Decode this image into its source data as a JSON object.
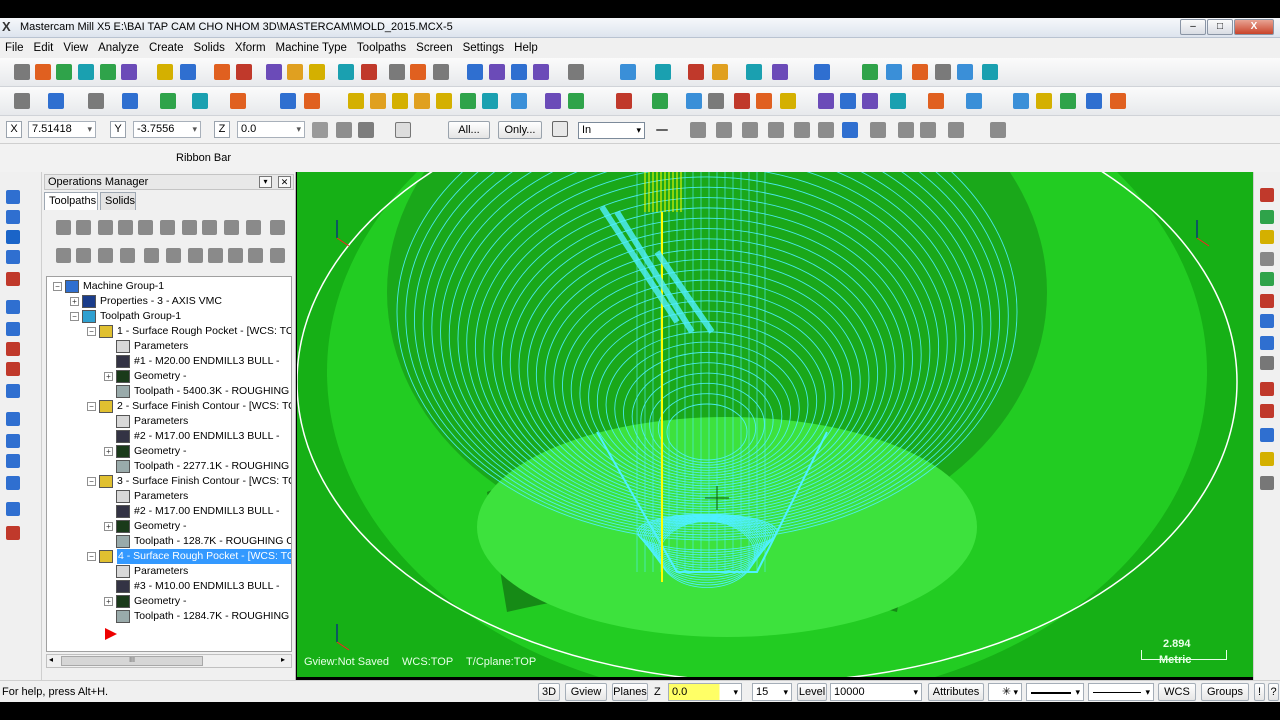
{
  "window": {
    "app_icon": "X",
    "title": "Mastercam Mill X5  E:\\BAI TAP CAM CHO NHOM 3D\\MASTERCAM\\MOLD_2015.MCX-5",
    "min": "–",
    "max": "□",
    "close": "X"
  },
  "menu": [
    "File",
    "Edit",
    "View",
    "Analyze",
    "Create",
    "Solids",
    "Xform",
    "Machine Type",
    "Toolpaths",
    "Screen",
    "Settings",
    "Help"
  ],
  "autocursor": {
    "x_label": "X",
    "x_value": "7.51418",
    "y_label": "Y",
    "y_value": "-3.7556",
    "z_label": "Z",
    "z_value": "0.0",
    "all_button": "All...",
    "only_button": "Only...",
    "mode_select": "In"
  },
  "ribbon_bar": "Ribbon Bar",
  "ops_manager": {
    "title": "Operations Manager",
    "tabs": [
      "Toolpaths",
      "Solids"
    ],
    "tree": [
      {
        "text": "Machine Group-1",
        "icon": "machine-group-icon",
        "level": 0,
        "exp": "−"
      },
      {
        "text": "Properties - 3 - AXIS VMC",
        "icon": "properties-icon",
        "level": 1,
        "exp": "+"
      },
      {
        "text": "Toolpath Group-1",
        "icon": "toolpath-group-icon",
        "level": 1,
        "exp": "−"
      },
      {
        "text": "1 - Surface Rough Pocket - [WCS: TOP",
        "icon": "operation-folder-icon",
        "level": 2,
        "exp": "−"
      },
      {
        "text": "Parameters",
        "icon": "parameters-icon",
        "level": 3,
        "exp": ""
      },
      {
        "text": "#1 - M20.00 ENDMILL3 BULL -",
        "icon": "tool-icon",
        "level": 3,
        "exp": ""
      },
      {
        "text": "Geometry -",
        "icon": "geometry-icon",
        "level": 3,
        "exp": "+"
      },
      {
        "text": "Toolpath - 5400.3K - ROUGHING",
        "icon": "toolpath-icon",
        "level": 3,
        "exp": ""
      },
      {
        "text": "2 - Surface Finish Contour - [WCS: TOP",
        "icon": "operation-folder-icon",
        "level": 2,
        "exp": "−"
      },
      {
        "text": "Parameters",
        "icon": "parameters-icon",
        "level": 3,
        "exp": ""
      },
      {
        "text": "#2 - M17.00 ENDMILL3 BULL -",
        "icon": "tool-icon",
        "level": 3,
        "exp": ""
      },
      {
        "text": "Geometry -",
        "icon": "geometry-icon",
        "level": 3,
        "exp": "+"
      },
      {
        "text": "Toolpath - 2277.1K - ROUGHING",
        "icon": "toolpath-icon",
        "level": 3,
        "exp": ""
      },
      {
        "text": "3 - Surface Finish Contour - [WCS: TOP",
        "icon": "operation-folder-icon",
        "level": 2,
        "exp": "−"
      },
      {
        "text": "Parameters",
        "icon": "parameters-icon",
        "level": 3,
        "exp": ""
      },
      {
        "text": "#2 - M17.00 ENDMILL3 BULL -",
        "icon": "tool-icon",
        "level": 3,
        "exp": ""
      },
      {
        "text": "Geometry -",
        "icon": "geometry-icon",
        "level": 3,
        "exp": "+"
      },
      {
        "text": "Toolpath - 128.7K - ROUGHING C",
        "icon": "toolpath-icon",
        "level": 3,
        "exp": ""
      },
      {
        "text": "4 - Surface Rough Pocket - [WCS: TOP",
        "icon": "operation-folder-icon",
        "level": 2,
        "exp": "−",
        "selected": true
      },
      {
        "text": "Parameters",
        "icon": "parameters-icon",
        "level": 3,
        "exp": ""
      },
      {
        "text": "#3 - M10.00 ENDMILL3 BULL -",
        "icon": "tool-icon",
        "level": 3,
        "exp": ""
      },
      {
        "text": "Geometry -",
        "icon": "geometry-icon",
        "level": 3,
        "exp": "+"
      },
      {
        "text": "Toolpath - 1284.7K - ROUGHING",
        "icon": "toolpath-icon",
        "level": 3,
        "exp": ""
      }
    ],
    "insert_arrow": "insert-arrow-icon",
    "scroll_thumb": "III"
  },
  "viewport": {
    "gview": "Gview:Not Saved",
    "wcs": "WCS:TOP",
    "tplane": "T/Cplane:TOP",
    "scale_value": "2.894",
    "scale_unit": "Metric",
    "axis_z": "Z",
    "axis_x": "X",
    "axis_c": "C",
    "axis_t": "T",
    "colors": {
      "part": "#1ec81e",
      "toolpath": "#4ff0ff",
      "highlight": "#ffff00",
      "edge": "#ffffff"
    }
  },
  "status": {
    "help": "For help, press Alt+H.",
    "btn_3d": "3D",
    "btn_gview": "Gview",
    "btn_planes": "Planes",
    "z_label": "Z",
    "z_value": "0.0",
    "color_value": "15",
    "level_label": "Level",
    "level_value": "10000",
    "attributes": "Attributes",
    "wcs": "WCS",
    "groups": "Groups",
    "bang": "!",
    "q": "?"
  }
}
